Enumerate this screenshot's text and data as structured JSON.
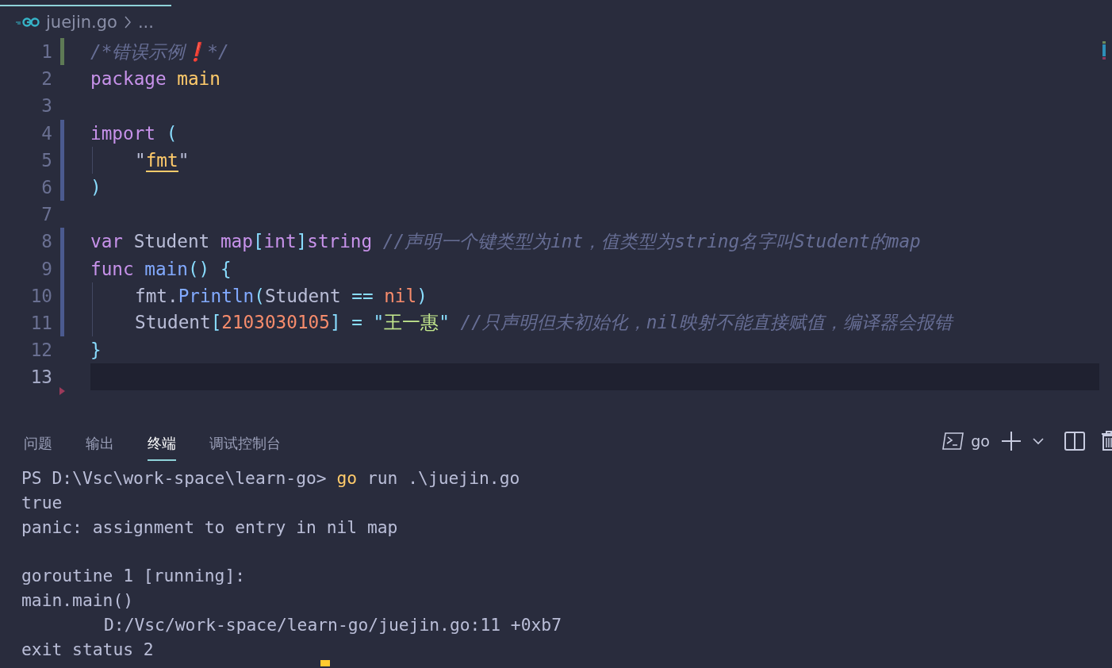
{
  "breadcrumb": {
    "file": "juejin.go",
    "more": "..."
  },
  "editor": {
    "lines": [
      {
        "number": "1",
        "added": true,
        "modified": false,
        "current": false,
        "indented": false,
        "tokens": [
          {
            "kind": "comment",
            "text": "/*错误示例"
          },
          {
            "kind": "emoji",
            "text": "❗"
          },
          {
            "kind": "comment",
            "text": "*/"
          }
        ]
      },
      {
        "number": "2",
        "added": false,
        "modified": false,
        "current": false,
        "indented": false,
        "tokens": [
          {
            "kind": "keyword",
            "text": "package "
          },
          {
            "kind": "name",
            "text": "main"
          }
        ]
      },
      {
        "number": "3",
        "added": false,
        "modified": false,
        "current": false,
        "indented": false
      },
      {
        "number": "4",
        "added": false,
        "modified": true,
        "current": false,
        "indented": false,
        "tokens": [
          {
            "kind": "keyword",
            "text": "import "
          },
          {
            "kind": "punct",
            "text": "("
          }
        ]
      },
      {
        "number": "5",
        "added": false,
        "modified": true,
        "current": false,
        "indented": true,
        "tokens": [
          {
            "kind": "plain",
            "text": "\""
          },
          {
            "kind": "path",
            "text": "fmt"
          },
          {
            "kind": "plain",
            "text": "\""
          }
        ]
      },
      {
        "number": "6",
        "added": false,
        "modified": true,
        "current": false,
        "indented": false,
        "tokens": [
          {
            "kind": "punct",
            "text": ")"
          }
        ]
      },
      {
        "number": "7",
        "added": false,
        "modified": false,
        "current": false,
        "indented": false
      },
      {
        "number": "8",
        "added": false,
        "modified": true,
        "current": false,
        "indented": false,
        "tokens": [
          {
            "kind": "keyword",
            "text": "var"
          },
          {
            "kind": "plain",
            "text": " Student "
          },
          {
            "kind": "keyword",
            "text": "map"
          },
          {
            "kind": "punct",
            "text": "["
          },
          {
            "kind": "keyword",
            "text": "int"
          },
          {
            "kind": "punct",
            "text": "]"
          },
          {
            "kind": "keyword",
            "text": "string "
          },
          {
            "kind": "comment",
            "text": "//声明一个键类型为int，值类型为string名字叫Student的map"
          }
        ]
      },
      {
        "number": "9",
        "added": false,
        "modified": true,
        "current": false,
        "indented": false,
        "tokens": [
          {
            "kind": "keyword",
            "text": "func "
          },
          {
            "kind": "function",
            "text": "main"
          },
          {
            "kind": "punct",
            "text": "() {"
          }
        ]
      },
      {
        "number": "10",
        "added": false,
        "modified": true,
        "current": false,
        "indented": true,
        "tokens": [
          {
            "kind": "plain",
            "text": "fmt."
          },
          {
            "kind": "function",
            "text": "Println"
          },
          {
            "kind": "punct",
            "text": "("
          },
          {
            "kind": "plain",
            "text": "Student "
          },
          {
            "kind": "operator",
            "text": "== "
          },
          {
            "kind": "constant",
            "text": "nil"
          },
          {
            "kind": "punct",
            "text": ")"
          }
        ]
      },
      {
        "number": "11",
        "added": false,
        "modified": true,
        "current": false,
        "indented": true,
        "tokens": [
          {
            "kind": "plain",
            "text": "Student"
          },
          {
            "kind": "punct",
            "text": "["
          },
          {
            "kind": "constant",
            "text": "2103030105"
          },
          {
            "kind": "punct",
            "text": "] "
          },
          {
            "kind": "operator",
            "text": "= "
          },
          {
            "kind": "punct",
            "text": "\""
          },
          {
            "kind": "string",
            "text": "王一惠"
          },
          {
            "kind": "punct",
            "text": "\" "
          },
          {
            "kind": "comment",
            "text": "//只声明但未初始化，nil映射不能直接赋值，编译器会报错"
          }
        ]
      },
      {
        "number": "12",
        "added": false,
        "modified": false,
        "current": false,
        "indented": false,
        "tokens": [
          {
            "kind": "punct",
            "text": "}"
          }
        ]
      },
      {
        "number": "13",
        "added": false,
        "modified": false,
        "current": true,
        "indented": false
      }
    ]
  },
  "panel": {
    "tabs": [
      {
        "label": "问题",
        "selected": false
      },
      {
        "label": "输出",
        "selected": false
      },
      {
        "label": "终端",
        "selected": true
      },
      {
        "label": "调试控制台",
        "selected": false
      }
    ],
    "shell": "go"
  },
  "terminal": {
    "lines": [
      {
        "kind": "text",
        "indented": false,
        "tokens": [
          {
            "kind": "plain",
            "text": "PS D:\\Vsc\\work-space\\learn-go> "
          },
          {
            "kind": "command",
            "text": "go"
          },
          {
            "kind": "plain",
            "text": " run .\\juejin.go"
          }
        ]
      },
      {
        "kind": "text",
        "indented": false,
        "tokens": [
          {
            "kind": "plain",
            "text": "true"
          }
        ]
      },
      {
        "kind": "text",
        "indented": false,
        "tokens": [
          {
            "kind": "plain",
            "text": "panic: assignment to entry in nil map"
          }
        ]
      },
      {
        "kind": "blank"
      },
      {
        "kind": "text",
        "indented": false,
        "tokens": [
          {
            "kind": "plain",
            "text": "goroutine 1 [running]:"
          }
        ]
      },
      {
        "kind": "text",
        "indented": false,
        "tokens": [
          {
            "kind": "plain",
            "text": "main.main()"
          }
        ]
      },
      {
        "kind": "text",
        "indented": true,
        "tokens": [
          {
            "kind": "plain",
            "text": "D:/Vsc/work-space/learn-go/juejin.go:11 +0xb7"
          }
        ]
      },
      {
        "kind": "text",
        "indented": false,
        "tokens": [
          {
            "kind": "plain",
            "text": "exit status 2"
          }
        ]
      }
    ]
  }
}
